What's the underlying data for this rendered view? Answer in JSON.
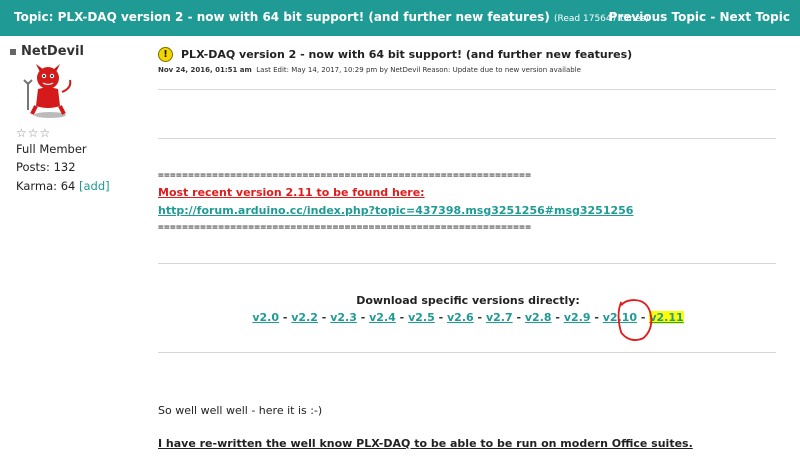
{
  "topbar": {
    "title": "Topic: PLX-DAQ version 2 - now with 64 bit support! (and further new features)",
    "read": "(Read 175647 times)",
    "prev": "Previous Topic",
    "sep": " - ",
    "next": "Next Topic"
  },
  "user": {
    "name": "NetDevil",
    "stars": "☆☆☆",
    "rank": "Full Member",
    "posts": "Posts: 132",
    "karma": "Karma: 64",
    "karma_add": "[add]"
  },
  "post": {
    "title": "PLX-DAQ version 2 - now with 64 bit support! (and further new features)",
    "date": "Nov 24, 2016, 01:51 am",
    "edit": "Last Edit: May 14, 2017, 10:29 pm by NetDevil Reason: Update due to new version available",
    "eq_line": "==============================================================",
    "recent_label": "Most recent version 2.11 to be found here:",
    "recent_link": "http://forum.arduino.cc/index.php?topic=437398.msg3251256#msg3251256",
    "download_heading": "Download specific versions directly:",
    "versions": [
      "v2.0",
      "v2.2",
      "v2.3",
      "v2.4",
      "v2.5",
      "v2.6",
      "v2.7",
      "v2.8",
      "v2.9",
      "v2.10",
      "v2.11"
    ],
    "version_sep": "-",
    "intro": "So well well well - here it is :-)",
    "rewritten": "I have re-written the well know PLX-DAQ to be able to be run on modern Office suites."
  },
  "colors": {
    "teal": "#1f9a94",
    "red": "#e01b1b",
    "highlight": "#ffff00"
  }
}
